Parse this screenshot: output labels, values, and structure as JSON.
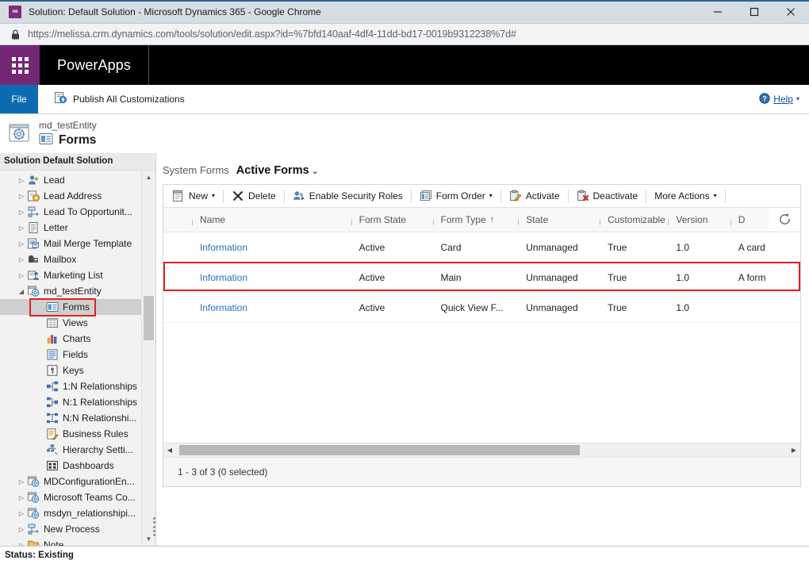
{
  "window": {
    "title": "Solution: Default Solution - Microsoft Dynamics 365 - Google Chrome",
    "minimize_label": "Minimize",
    "maximize_label": "Maximize",
    "close_label": "Close"
  },
  "browser": {
    "url": "https://melissa.crm.dynamics.com/tools/solution/edit.aspx?id=%7bfd140aaf-4df4-11dd-bd17-0019b9312238%7d#",
    "lock_icon": "lock-icon"
  },
  "appbar": {
    "waffle_icon": "app-launcher-icon",
    "brand": "PowerApps"
  },
  "ribbon": {
    "file_label": "File",
    "publish_label": "Publish All Customizations",
    "publish_icon": "publish-icon",
    "help_label": "Help",
    "help_icon": "help-icon",
    "help_caret": "▾"
  },
  "entity_header": {
    "icon": "entity-icon",
    "subtitle": "md_testEntity",
    "form_icon": "forms-icon",
    "title": "Forms"
  },
  "sidebar": {
    "solution_header": "Solution Default Solution",
    "scroll_up": "▲",
    "scroll_down": "▼",
    "items": [
      {
        "label": "Lead",
        "level": 1,
        "twisty": "▷",
        "icon": "lead-icon",
        "selected": false
      },
      {
        "label": "Lead Address",
        "level": 1,
        "twisty": "▷",
        "icon": "lead-address-icon",
        "selected": false
      },
      {
        "label": "Lead To Opportunit...",
        "level": 1,
        "twisty": "▷",
        "icon": "process-icon",
        "selected": false
      },
      {
        "label": "Letter",
        "level": 1,
        "twisty": "▷",
        "icon": "letter-icon",
        "selected": false
      },
      {
        "label": "Mail Merge Template",
        "level": 1,
        "twisty": "▷",
        "icon": "mail-merge-icon",
        "selected": false
      },
      {
        "label": "Mailbox",
        "level": 1,
        "twisty": "▷",
        "icon": "mailbox-icon",
        "selected": false
      },
      {
        "label": "Marketing List",
        "level": 1,
        "twisty": "▷",
        "icon": "marketing-list-icon",
        "selected": false
      },
      {
        "label": "md_testEntity",
        "level": 1,
        "twisty": "◢",
        "icon": "entity-icon",
        "selected": false
      },
      {
        "label": "Forms",
        "level": 2,
        "twisty": "",
        "icon": "forms-icon",
        "selected": true
      },
      {
        "label": "Views",
        "level": 2,
        "twisty": "",
        "icon": "views-icon",
        "selected": false
      },
      {
        "label": "Charts",
        "level": 2,
        "twisty": "",
        "icon": "charts-icon",
        "selected": false
      },
      {
        "label": "Fields",
        "level": 2,
        "twisty": "",
        "icon": "fields-icon",
        "selected": false
      },
      {
        "label": "Keys",
        "level": 2,
        "twisty": "",
        "icon": "keys-icon",
        "selected": false
      },
      {
        "label": "1:N Relationships",
        "level": 2,
        "twisty": "",
        "icon": "one-to-many-icon",
        "selected": false
      },
      {
        "label": "N:1 Relationships",
        "level": 2,
        "twisty": "",
        "icon": "many-to-one-icon",
        "selected": false
      },
      {
        "label": "N:N Relationshi...",
        "level": 2,
        "twisty": "",
        "icon": "many-to-many-icon",
        "selected": false
      },
      {
        "label": "Business Rules",
        "level": 2,
        "twisty": "",
        "icon": "business-rules-icon",
        "selected": false
      },
      {
        "label": "Hierarchy Setti...",
        "level": 2,
        "twisty": "",
        "icon": "hierarchy-icon",
        "selected": false
      },
      {
        "label": "Dashboards",
        "level": 2,
        "twisty": "",
        "icon": "dashboards-icon",
        "selected": false
      },
      {
        "label": "MDConfigurationEn...",
        "level": 1,
        "twisty": "▷",
        "icon": "entity-icon",
        "selected": false
      },
      {
        "label": "Microsoft Teams Co...",
        "level": 1,
        "twisty": "▷",
        "icon": "entity-icon",
        "selected": false
      },
      {
        "label": "msdyn_relationshipi...",
        "level": 1,
        "twisty": "▷",
        "icon": "entity-icon",
        "selected": false
      },
      {
        "label": "New Process",
        "level": 1,
        "twisty": "▷",
        "icon": "process-icon",
        "selected": false
      },
      {
        "label": "Note",
        "level": 1,
        "twisty": "▷",
        "icon": "note-icon",
        "selected": false
      }
    ]
  },
  "view": {
    "system_label": "System Forms",
    "active_label": "Active Forms",
    "caret": "⌄"
  },
  "commands": [
    {
      "label": "New",
      "icon": "new-icon",
      "caret": "▾"
    },
    {
      "label": "Delete",
      "icon": "delete-icon",
      "caret": ""
    },
    {
      "label": "Enable Security Roles",
      "icon": "security-roles-icon",
      "caret": ""
    },
    {
      "label": "Form Order",
      "icon": "form-order-icon",
      "caret": "▾"
    },
    {
      "label": "Activate",
      "icon": "activate-icon",
      "caret": ""
    },
    {
      "label": "Deactivate",
      "icon": "deactivate-icon",
      "caret": ""
    },
    {
      "label": "More Actions",
      "icon": "",
      "caret": "▾"
    }
  ],
  "grid": {
    "columns": [
      {
        "key": "name",
        "label": "Name",
        "sort": ""
      },
      {
        "key": "state",
        "label": "Form State",
        "sort": ""
      },
      {
        "key": "type",
        "label": "Form Type",
        "sort": "↑"
      },
      {
        "key": "st",
        "label": "State",
        "sort": ""
      },
      {
        "key": "cust",
        "label": "Customizable",
        "sort": ""
      },
      {
        "key": "ver",
        "label": "Version",
        "sort": ""
      },
      {
        "key": "desc",
        "label": "D",
        "sort": ""
      }
    ],
    "refresh_icon": "refresh-spinner-icon",
    "rows": [
      {
        "name": "Information",
        "state": "Active",
        "type": "Card",
        "st": "Unmanaged",
        "cust": "True",
        "ver": "1.0",
        "desc": "A card",
        "highlighted": false
      },
      {
        "name": "Information",
        "state": "Active",
        "type": "Main",
        "st": "Unmanaged",
        "cust": "True",
        "ver": "1.0",
        "desc": "A form",
        "highlighted": true
      },
      {
        "name": "Information",
        "state": "Active",
        "type": "Quick View F...",
        "st": "Unmanaged",
        "cust": "True",
        "ver": "1.0",
        "desc": "",
        "highlighted": false
      }
    ],
    "scroll_left": "◀",
    "scroll_right": "▶",
    "footer": "1 - 3 of 3 (0 selected)"
  },
  "statusbar": {
    "text": "Status: Existing"
  },
  "colors": {
    "accent_purple": "#742774",
    "file_blue": "#0d6bb2",
    "link_blue": "#2a6fbb",
    "highlight_red": "#e02020",
    "selection_gray": "#cfcfcf"
  }
}
